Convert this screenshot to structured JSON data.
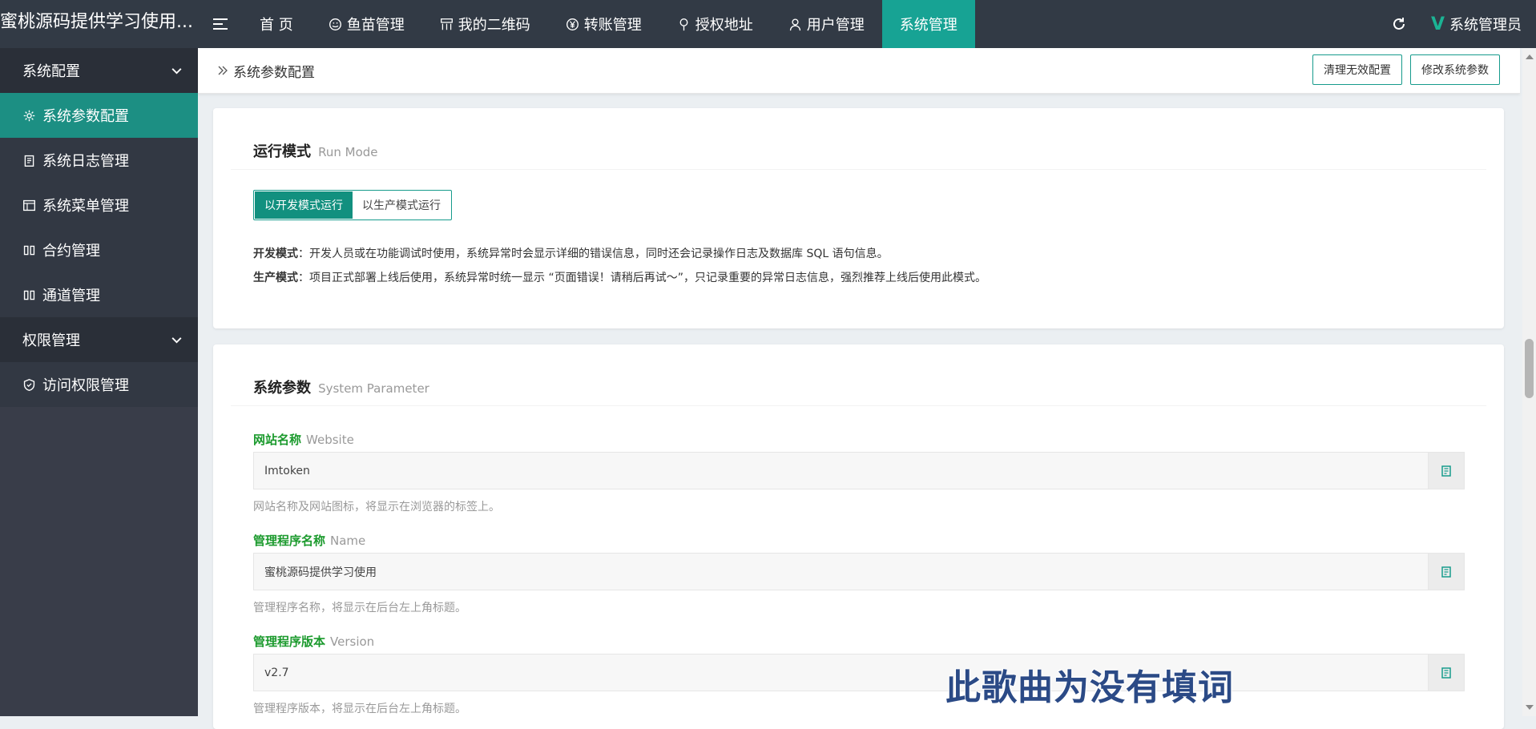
{
  "app": {
    "title": "蜜桃源码提供学习使用..."
  },
  "nav": {
    "items": [
      {
        "label": "首 页",
        "icon": "none"
      },
      {
        "label": "鱼苗管理",
        "icon": "smile-icon"
      },
      {
        "label": "我的二维码",
        "icon": "grid-icon"
      },
      {
        "label": "转账管理",
        "icon": "yen-icon"
      },
      {
        "label": "授权地址",
        "icon": "location-icon"
      },
      {
        "label": "用户管理",
        "icon": "user-icon"
      },
      {
        "label": "系统管理",
        "icon": "none",
        "active": true
      }
    ]
  },
  "user": {
    "name": "系统管理员"
  },
  "sidebar": {
    "group1": "系统配置",
    "items1": [
      {
        "label": "系统参数配置",
        "icon": "gear-icon",
        "active": true
      },
      {
        "label": "系统日志管理",
        "icon": "clipboard-icon"
      },
      {
        "label": "系统菜单管理",
        "icon": "window-icon"
      },
      {
        "label": "合约管理",
        "icon": "columns-icon"
      },
      {
        "label": "通道管理",
        "icon": "columns-icon"
      }
    ],
    "group2": "权限管理",
    "items2": [
      {
        "label": "访问权限管理",
        "icon": "shield-icon"
      }
    ]
  },
  "breadcrumb": {
    "current": "系统参数配置"
  },
  "toolbar": {
    "clean_label": "清理无效配置",
    "edit_label": "修改系统参数"
  },
  "run_mode": {
    "title": "运行模式",
    "subtitle": "Run Mode",
    "dev_button": "以开发模式运行",
    "prod_button": "以生产模式运行",
    "dev_label": "开发模式",
    "dev_text": "：开发人员或在功能调试时使用，系统异常时会显示详细的错误信息，同时还会记录操作日志及数据库 SQL 语句信息。",
    "prod_label": "生产模式",
    "prod_text": "：项目正式部署上线后使用，系统异常时统一显示 “页面错误！请稍后再试～”，只记录重要的异常日志信息，强烈推荐上线后使用此模式。"
  },
  "sys_params": {
    "title": "系统参数",
    "subtitle": "System Parameter",
    "fields": [
      {
        "label": "网站名称",
        "en": "Website",
        "value": "Imtoken",
        "help": "网站名称及网站图标，将显示在浏览器的标签上。"
      },
      {
        "label": "管理程序名称",
        "en": "Name",
        "value": "蜜桃源码提供学习使用",
        "help": "管理程序名称，将显示在后台左上角标题。"
      },
      {
        "label": "管理程序版本",
        "en": "Version",
        "value": "v2.7",
        "help": "管理程序版本，将显示在后台左上角标题。"
      }
    ]
  },
  "watermark": "此歌曲为没有填词",
  "colors": {
    "accent": "#17a394",
    "topbar": "#323a45",
    "sidebar": "#2a2f38",
    "label_green": "#1b9a2d"
  }
}
